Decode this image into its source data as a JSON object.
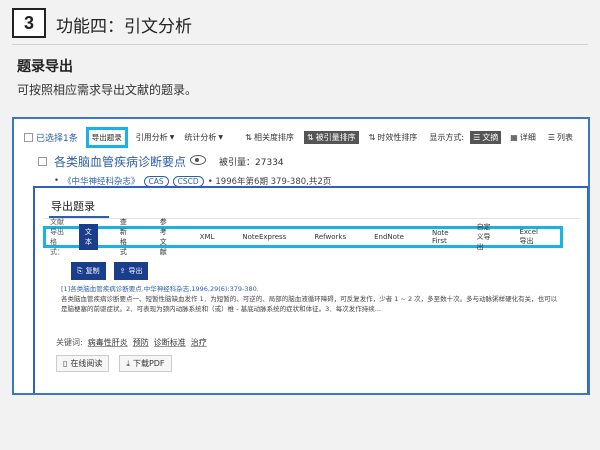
{
  "header": {
    "step_number": "3",
    "title": "功能四：引文分析"
  },
  "section": {
    "title": "题录导出",
    "description": "可按照相应需求导出文献的题录。"
  },
  "toolbar": {
    "selected_label": "已选择1条",
    "export_label": "导出题录",
    "cite_analysis_label": "引用分析",
    "stats_analysis_label": "统计分析",
    "sort_relevance": "相关度排序",
    "sort_cited": "被引量排序",
    "sort_time": "时效性排序",
    "view_label": "显示方式:",
    "view_summary": "文摘",
    "view_detail": "详细",
    "view_list": "列表"
  },
  "article": {
    "title": "各类脑血管疾病诊断要点",
    "cited_label": "被引量：",
    "cited_count": "27334",
    "journal": "《中华神经科杂志》",
    "tag1": "CAS",
    "tag2": "CSCD",
    "issue_info": "• 1996年第6期 379-380,共2页",
    "keywords_label": "关键词:",
    "keywords": [
      "病毒性肝炎",
      "预防",
      "诊断标准",
      "治疗"
    ],
    "read_online": "在线阅读",
    "download_pdf": "下载PDF"
  },
  "panel": {
    "title": "导出题录",
    "format_label": "文献导出格式：",
    "formats": [
      "文本",
      "查新格式",
      "参考文献",
      "XML",
      "NoteExpress",
      "Refworks",
      "EndNote",
      "Note First",
      "自定义导出",
      "Excel导出"
    ],
    "copy_label": "复制",
    "export_label": "导出",
    "citation_ref": "[1]各类脑血管疾病诊断要点.中华神经科杂志,1996,29(6):379-380.",
    "citation_text": "各类脑血管疾病诊断要点一、短暂性脑缺血发作 1．为短暂的、可逆的、局部的脑血液循环障碍，可反复发作，少者 1 ~ 2 次，多至数十次。多与动脉粥样硬化有关，也可以是脑梗塞的前驱症状。2．可表现为颈内动脉系统和（或）椎 - 基底动脉系统的症状和体征。3．每次发作持续..."
  },
  "colors": {
    "frame": "#3a78c7",
    "highlight": "#17b3e3",
    "primary": "#1a3e8c",
    "link": "#2e5fa8"
  }
}
